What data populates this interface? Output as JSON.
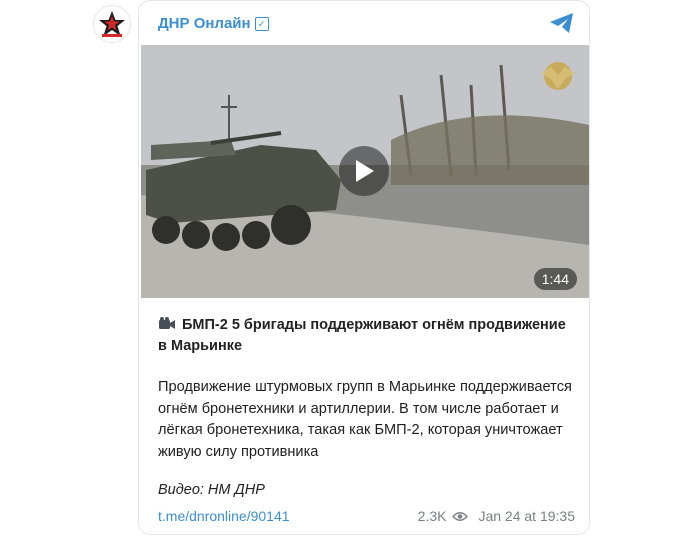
{
  "channel": {
    "name": "ДНР Онлайн",
    "verified_mark": "✓"
  },
  "post": {
    "video_duration": "1:44",
    "headline": "БМП-2 5 бригады поддерживают огнём продвижение в Марьинке",
    "body": "Продвижение штурмовых групп в Марьинке поддерживается огнём бронетехники и артиллерии. В том числе работает и лёгкая бронетехника, такая как БМП-2, которая уничтожает живую силу противника",
    "credit": "Видео: НМ ДНР",
    "link": "t.me/dnronline/90141",
    "views": "2.3K",
    "date": "Jan 24 at 19:35"
  },
  "colors": {
    "accent": "#3b8fd1",
    "meta": "#7b8087"
  },
  "icons": [
    "star-logo-icon",
    "telegram-icon",
    "play-icon",
    "eye-icon",
    "camera-icon",
    "emblem-icon"
  ]
}
